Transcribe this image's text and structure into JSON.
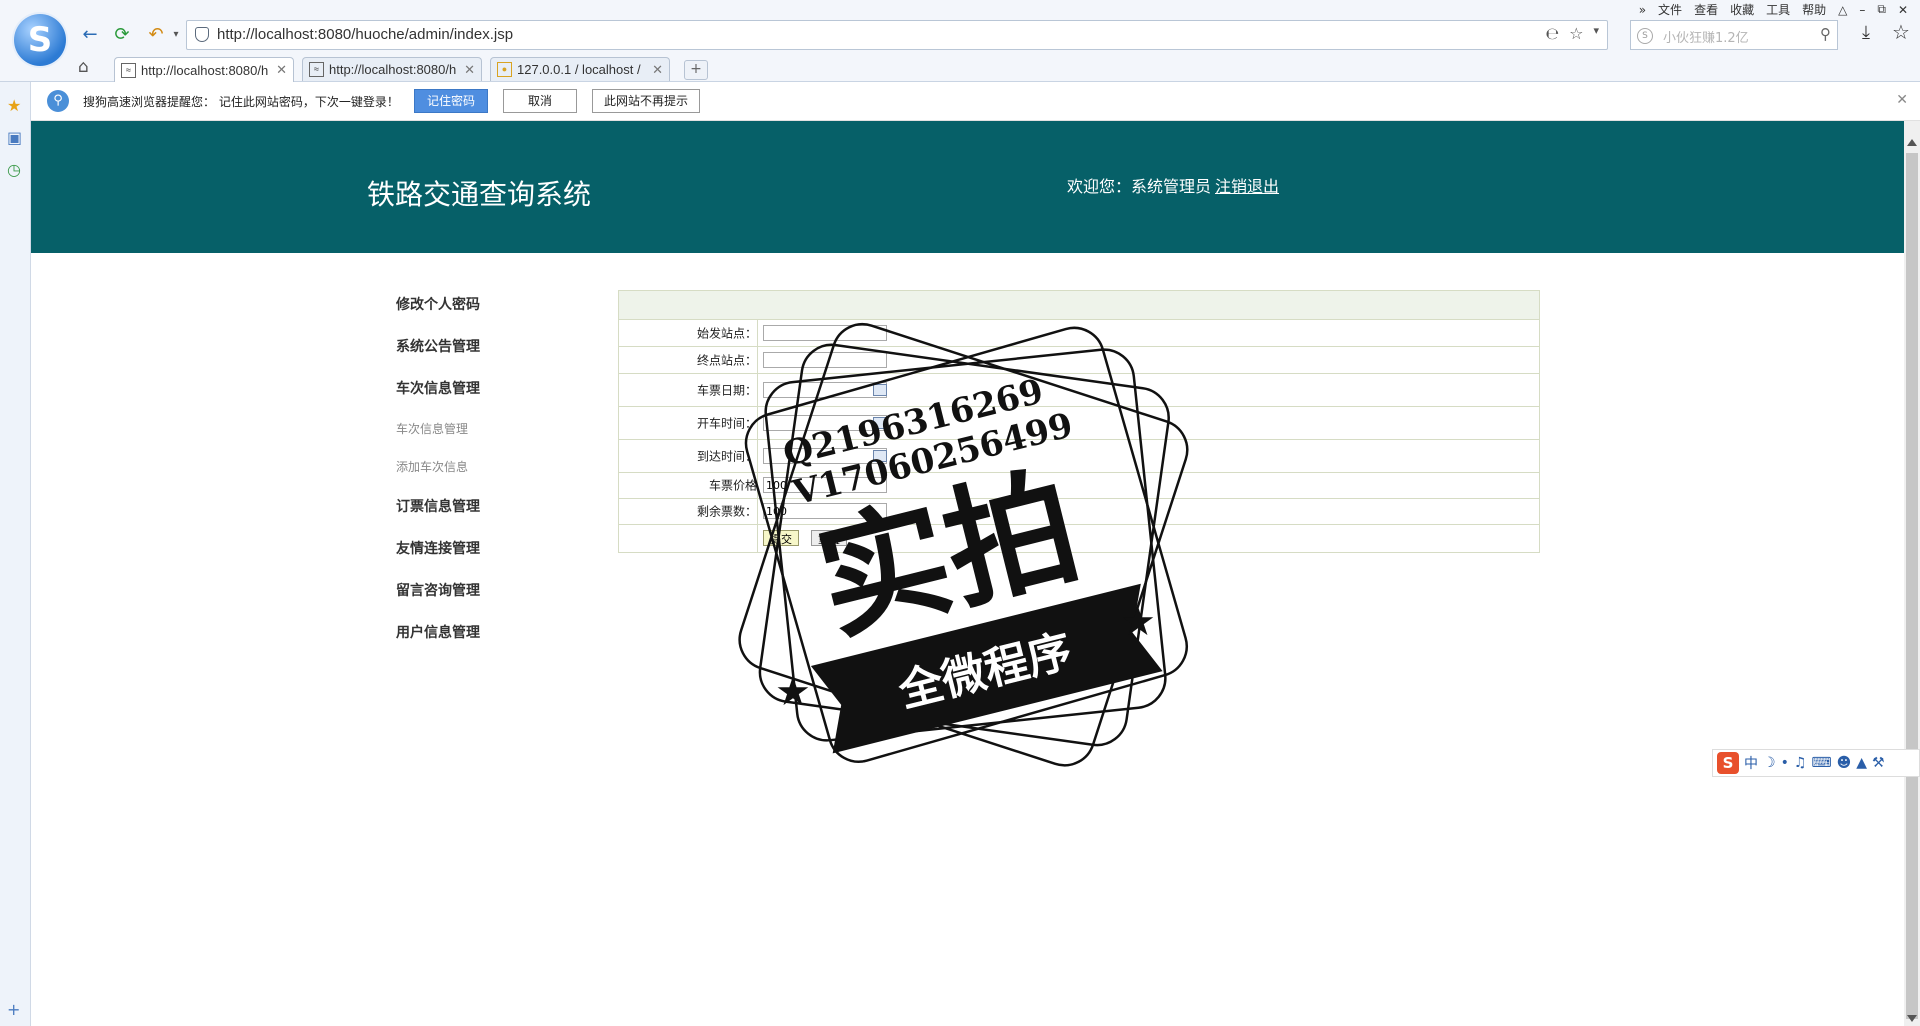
{
  "browser": {
    "url": "http://localhost:8080/huoche/admin/index.jsp",
    "search_placeholder": "小伙狂赚1.2亿",
    "menu": [
      "文件",
      "查看",
      "收藏",
      "工具",
      "帮助"
    ],
    "tabs": [
      {
        "title": "http://localhost:8080/h",
        "active": true
      },
      {
        "title": "http://localhost:8080/h",
        "active": false
      },
      {
        "title": "127.0.0.1 / localhost /",
        "active": false
      }
    ],
    "new_tab": "+"
  },
  "password_bar": {
    "message": "搜狗高速浏览器提醒您： 记住此网站密码，下次一键登录！",
    "remember": "记住密码",
    "cancel": "取消",
    "never": "此网站不再提示"
  },
  "header": {
    "title": "铁路交通查询系统",
    "welcome": "欢迎您：系统管理员",
    "logout": "注销退出"
  },
  "menu": {
    "change_password": "修改个人密码",
    "notice": "系统公告管理",
    "train": "车次信息管理",
    "train_sub1": "车次信息管理",
    "train_sub2": "添加车次信息",
    "ticket": "订票信息管理",
    "links": "友情连接管理",
    "message": "留言咨询管理",
    "users": "用户信息管理"
  },
  "form": {
    "start_label": "始发站点：",
    "end_label": "终点站点：",
    "date_label": "车票日期：",
    "depart_label": "开车时间：",
    "arrive_label": "到达时间：",
    "price_label": "车票价格",
    "remain_label": "剩余票数：",
    "price_value": "100",
    "remain_value": "100",
    "submit": "提交",
    "reset": "重置"
  },
  "watermark": {
    "qq": "Q2196316269",
    "wechat": "V17060256499",
    "main": "实拍",
    "banner": "全微程序"
  },
  "ime": {
    "label": "中"
  },
  "colors": {
    "header_bg": "#066068",
    "page_bg": "#ffffff"
  }
}
